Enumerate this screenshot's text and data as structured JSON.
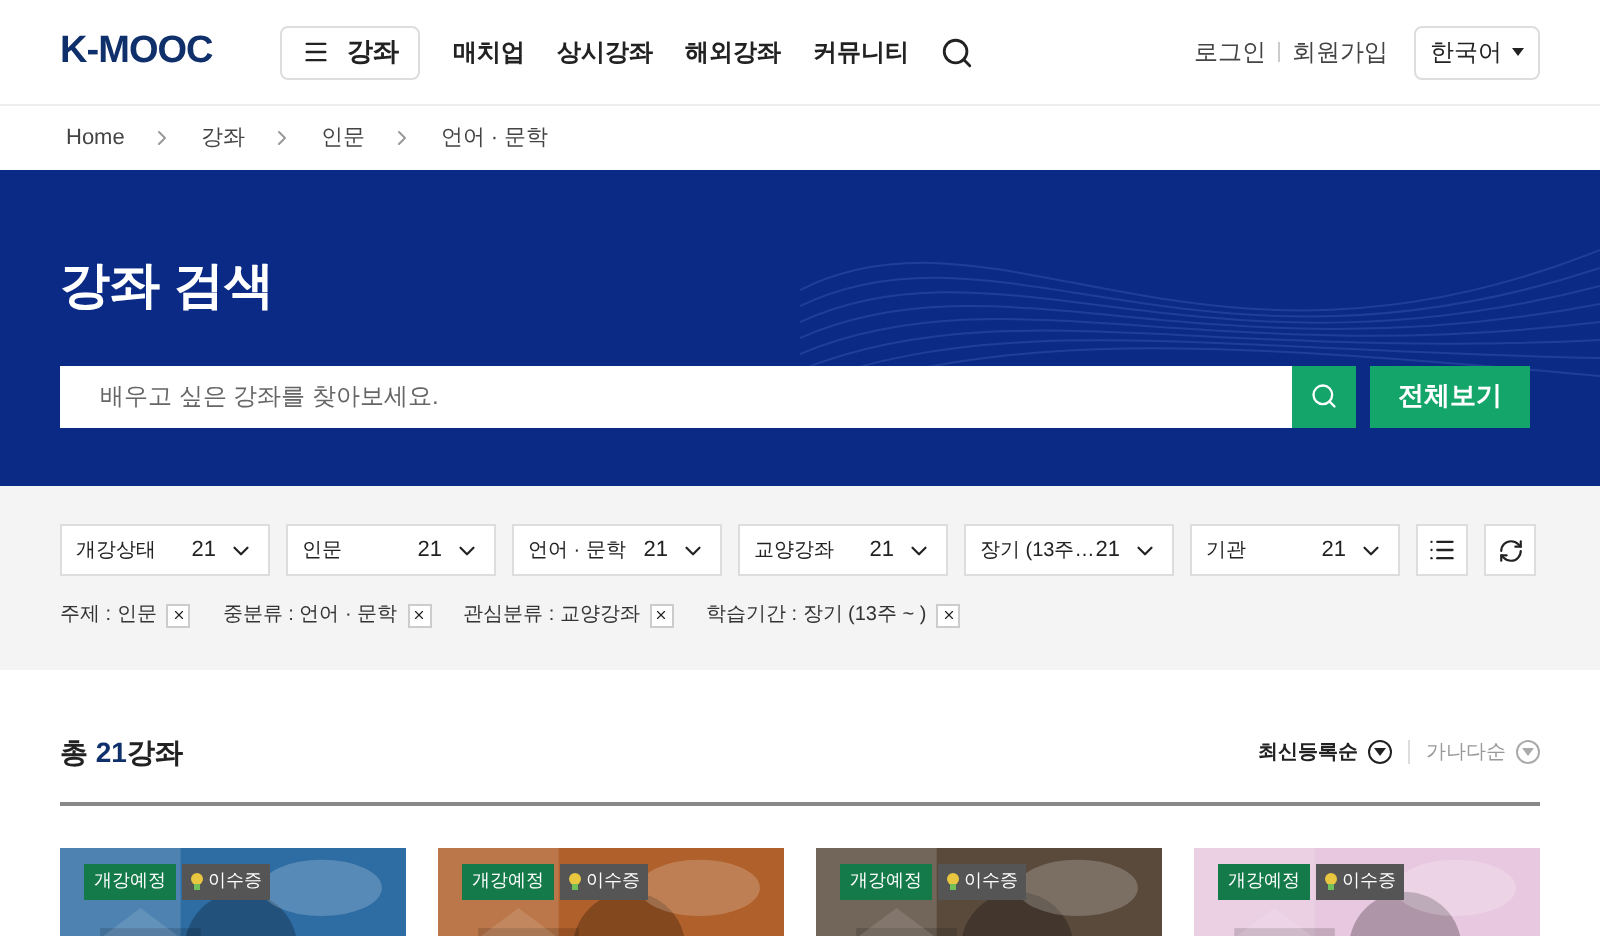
{
  "logo": "K-MOOC",
  "nav": {
    "menu_button": "강좌",
    "items": [
      "매치업",
      "상시강좌",
      "해외강좌",
      "커뮤니티"
    ],
    "login": "로그인",
    "signup": "회원가입",
    "language": "한국어"
  },
  "breadcrumb": [
    "Home",
    "강좌",
    "인문",
    "언어 · 문학"
  ],
  "banner": {
    "title": "강좌 검색",
    "search": {
      "placeholder": "배우고 싶은 강좌를 찾아보세요."
    },
    "view_all": "전체보기"
  },
  "filters": [
    {
      "label": "개강상태",
      "count": "21"
    },
    {
      "label": "인문",
      "count": "21"
    },
    {
      "label": "언어 · 문학",
      "count": "21"
    },
    {
      "label": "교양강좌",
      "count": "21"
    },
    {
      "label": "장기 (13주…",
      "count": "21"
    },
    {
      "label": "기관",
      "count": "21"
    }
  ],
  "tags": [
    "주제 : 인문",
    "중분류 : 언어 · 문학",
    "관심분류 : 교양강좌",
    "학습기간 : 장기 (13주 ~ )"
  ],
  "results": {
    "prefix": "총",
    "count": "21",
    "suffix": "강좌"
  },
  "sort": [
    {
      "label": "최신등록순",
      "selected": true
    },
    {
      "label": "가나다순",
      "selected": false
    }
  ],
  "courses": [
    {
      "status": "개강예정",
      "badge": "이수증",
      "kind": "picture"
    },
    {
      "status": "개강예정",
      "badge": "이수증",
      "kind": "picture"
    },
    {
      "status": "개강예정",
      "badge": "이수증",
      "kind": "picture"
    },
    {
      "status": "개강예정",
      "badge": "이수증",
      "kind": "picture"
    }
  ]
}
